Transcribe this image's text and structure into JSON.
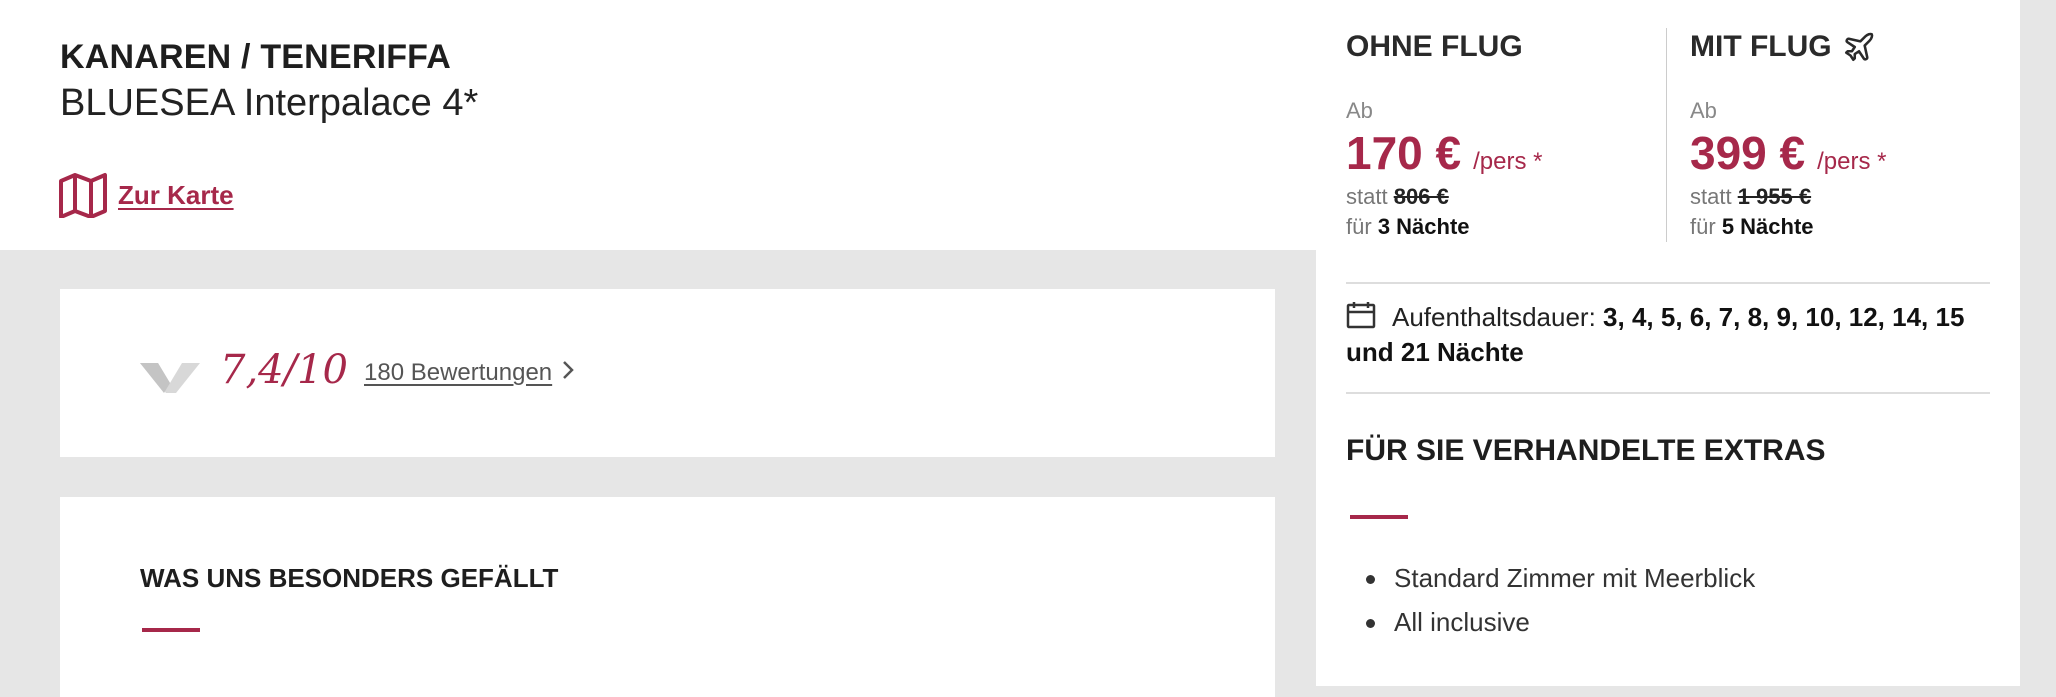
{
  "hotel": {
    "region": "KANAREN / TENERIFFA",
    "name": "BLUESEA Interpalace 4*",
    "map_link": "Zur Karte"
  },
  "rating": {
    "score": "7,4/10",
    "reviews_link": "180 Bewertungen"
  },
  "highlights": {
    "title": "WAS UNS BESONDERS GEFÄLLT"
  },
  "pricing": {
    "without_flight": {
      "title": "OHNE FLUG",
      "from_label": "Ab",
      "price": "170 €",
      "per": "/pers *",
      "statt_label": "statt",
      "old_price": "806 €",
      "nights_prefix": "für",
      "nights": "3 Nächte"
    },
    "with_flight": {
      "title": "MIT FLUG",
      "icon": "airplane-icon",
      "from_label": "Ab",
      "price": "399 €",
      "per": "/pers *",
      "statt_label": "statt",
      "old_price": "1 955 €",
      "nights_prefix": "für",
      "nights": "5 Nächte"
    }
  },
  "stay": {
    "label": "Aufenthaltsdauer:",
    "values": "3, 4, 5, 6, 7, 8, 9, 10, 12, 14, 15 und 21 Nächte"
  },
  "extras": {
    "title": "FÜR SIE VERHANDELTE EXTRAS",
    "items": [
      "Standard Zimmer mit Meerblick",
      "All inclusive"
    ]
  },
  "colors": {
    "accent": "#a6284a",
    "background": "#e6e6e6"
  }
}
